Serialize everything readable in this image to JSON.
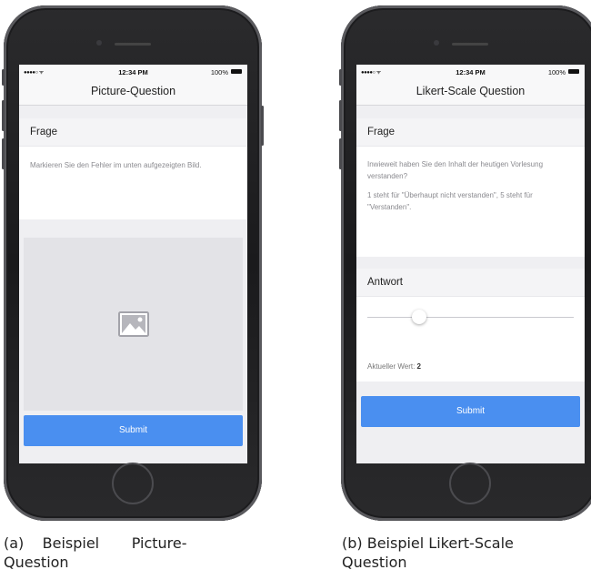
{
  "phone_a": {
    "status": {
      "signal": "●●●●○ ᯤ",
      "time": "12:34 PM",
      "battery": "100%"
    },
    "nav_title": "Picture-Question",
    "question_header": "Frage",
    "question_text": "Markieren Sie den Fehler im unten aufgezeigten Bild.",
    "picture_icon": "image-placeholder-icon",
    "submit_label": "Submit",
    "caption_line1": "(a)    Beispiel       Picture-",
    "caption_line2": "Question"
  },
  "phone_b": {
    "status": {
      "signal": "●●●●○ ᯤ",
      "time": "12:34 PM",
      "battery": "100%"
    },
    "nav_title": "Likert-Scale Question",
    "question_header": "Frage",
    "question_text_1": "Inwieweit haben Sie den Inhalt der heutigen Vorlesung verstanden?",
    "question_text_2": "1 steht für \"Überhaupt nicht verstanden\", 5 steht für \"Verstanden\".",
    "answer_header": "Antwort",
    "slider_value": 2,
    "slider_min": 1,
    "slider_max": 5,
    "current_value_label": "Aktueller Wert:",
    "current_value": "2",
    "submit_label": "Submit",
    "caption_line1": "(b) Beispiel Likert-Scale",
    "caption_line2": "Question"
  },
  "colors": {
    "accent": "#4a8ff0",
    "screen_bg": "#efeff2",
    "phone_body": "#1c1c1e"
  }
}
